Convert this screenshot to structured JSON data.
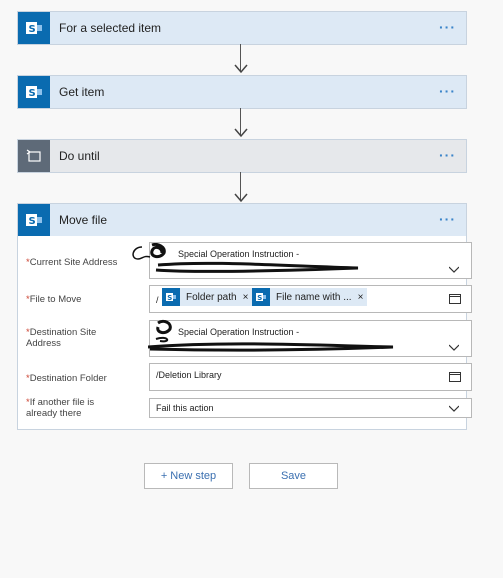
{
  "steps": [
    {
      "title": "For a selected item",
      "kind": "sharepoint"
    },
    {
      "title": "Get item",
      "kind": "sharepoint"
    },
    {
      "title": "Do until",
      "kind": "control"
    },
    {
      "title": "Move file",
      "kind": "sharepoint"
    }
  ],
  "more_glyph": "···",
  "icons": {
    "sharepoint": "sharepoint-icon",
    "control": "do-until-icon",
    "chevron": "chevron-down-icon",
    "folder": "folder-icon"
  },
  "move_file": {
    "fields": {
      "current_site": {
        "label": "Current Site Address",
        "value": "Special Operation Instruction -"
      },
      "file_to_move": {
        "label": "File to Move",
        "prefix": "/",
        "tokens": [
          {
            "label": "Folder path",
            "close": "×"
          },
          {
            "label": "File name with ...",
            "close": "×"
          }
        ]
      },
      "dest_site": {
        "label": "Destination Site Address",
        "value": "Special Operation Instruction -"
      },
      "dest_folder": {
        "label": "Destination Folder",
        "value": "/Deletion Library"
      },
      "if_exists": {
        "label": "If another file is already there",
        "value": "Fail this action"
      }
    },
    "required_marker": "*"
  },
  "buttons": {
    "new_step": "+ New step",
    "save": "Save"
  },
  "colors": {
    "sharepoint": "#0a6bb0",
    "control": "#5e6a78",
    "link": "#3a84c9"
  }
}
